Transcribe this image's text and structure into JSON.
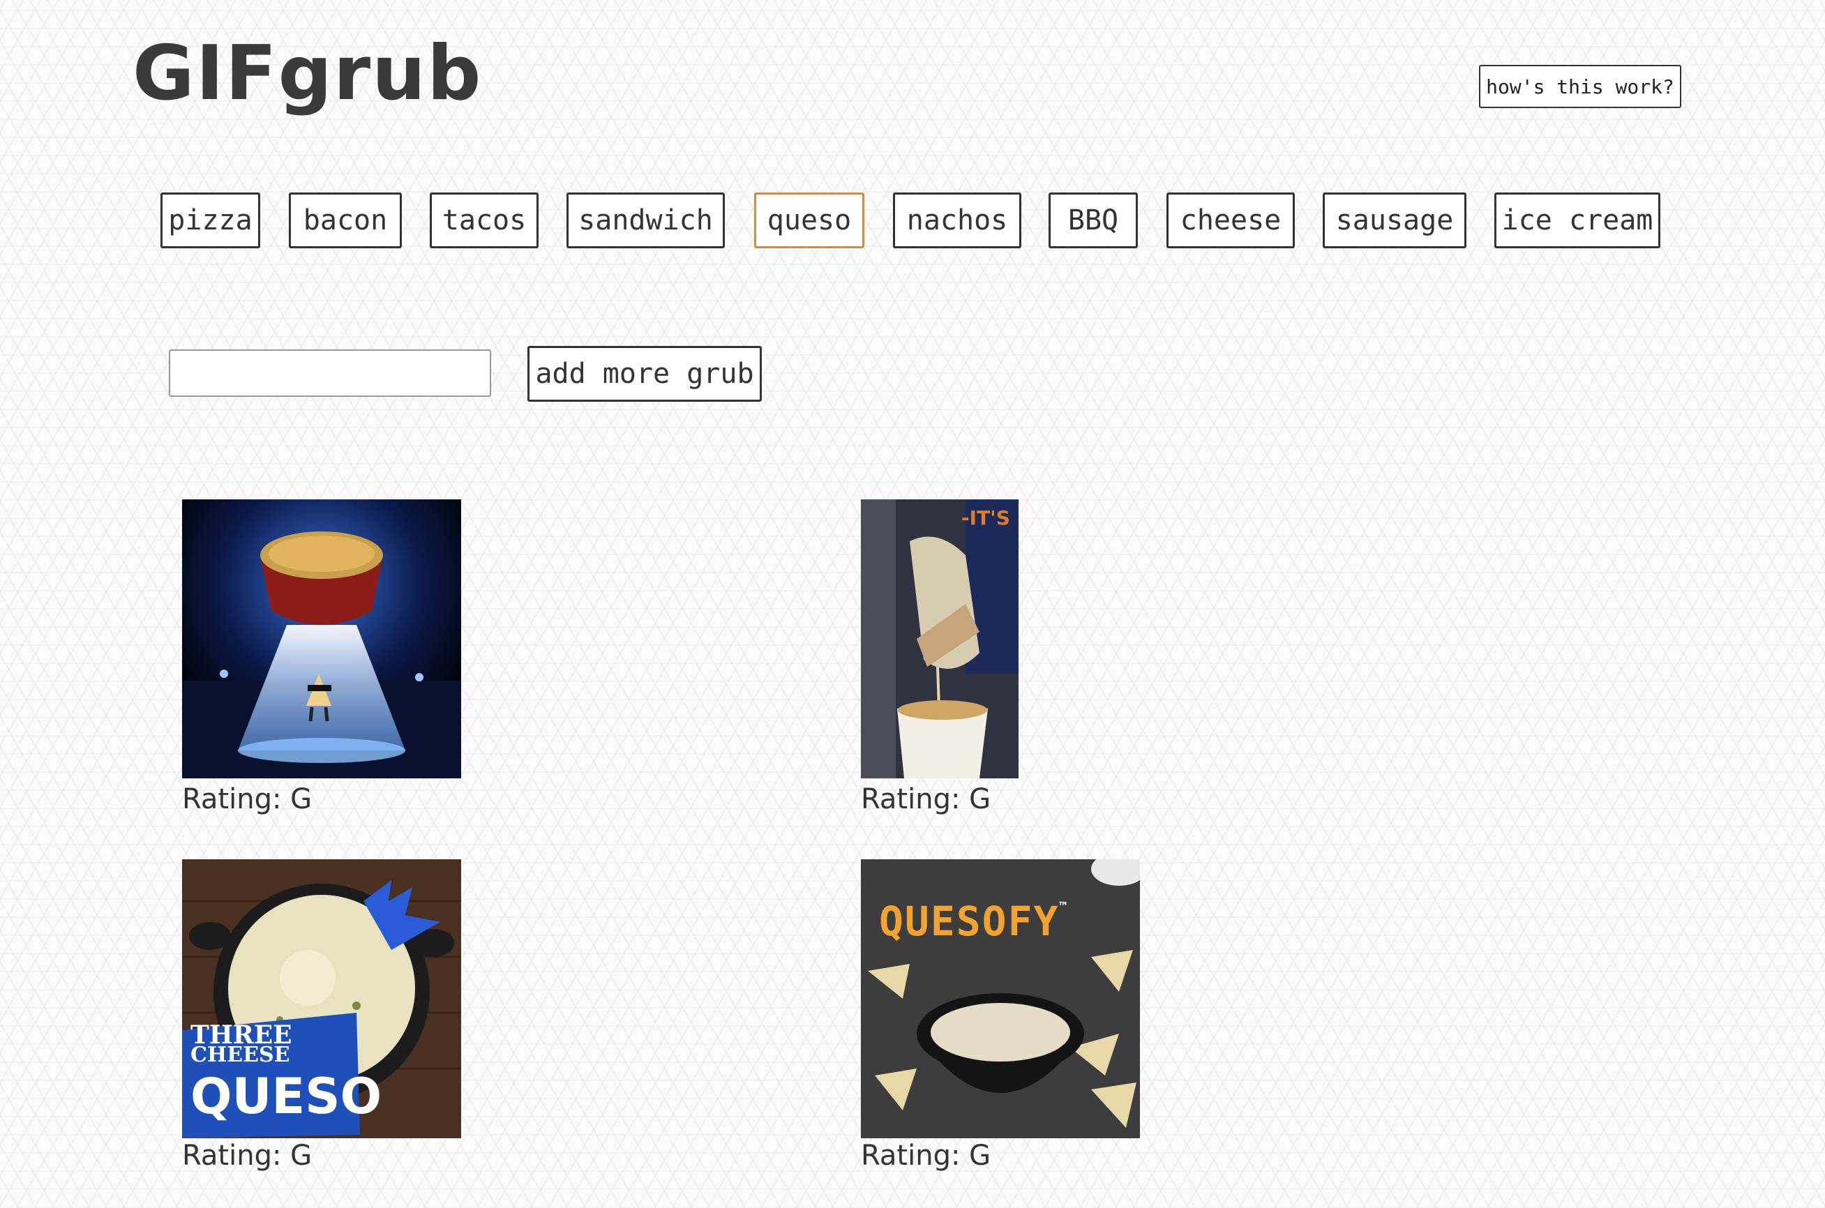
{
  "header": {
    "title": "GIFgrub",
    "help_label": "how's this work?"
  },
  "topics": [
    {
      "label": "pizza",
      "active": false
    },
    {
      "label": "bacon",
      "active": false
    },
    {
      "label": "tacos",
      "active": false
    },
    {
      "label": "sandwich",
      "active": false
    },
    {
      "label": "queso",
      "active": true
    },
    {
      "label": "nachos",
      "active": false
    },
    {
      "label": "BBQ",
      "active": false
    },
    {
      "label": "cheese",
      "active": false
    },
    {
      "label": "sausage",
      "active": false
    },
    {
      "label": "ice cream",
      "active": false
    }
  ],
  "add_form": {
    "input_value": "",
    "button_label": "add more grub"
  },
  "gifs": [
    {
      "rating_text": "Rating: G",
      "image": "queso-cup-ufo-beam"
    },
    {
      "rating_text": "Rating: G",
      "image": "chip-dipping-queso",
      "overlay_text": "-IT'S"
    },
    {
      "rating_text": "Rating: G",
      "image": "three-cheese-queso-skillet",
      "overlay_text_1": "THREE",
      "overlay_text_2": "CHEESE",
      "overlay_text_3": "QUESO"
    },
    {
      "rating_text": "Rating: G",
      "image": "quesofy-bowl-chips",
      "overlay_text": "QUESOFY",
      "overlay_mark": "™"
    }
  ],
  "colors": {
    "active_topic_border": "#d58b45",
    "text": "#333333"
  }
}
